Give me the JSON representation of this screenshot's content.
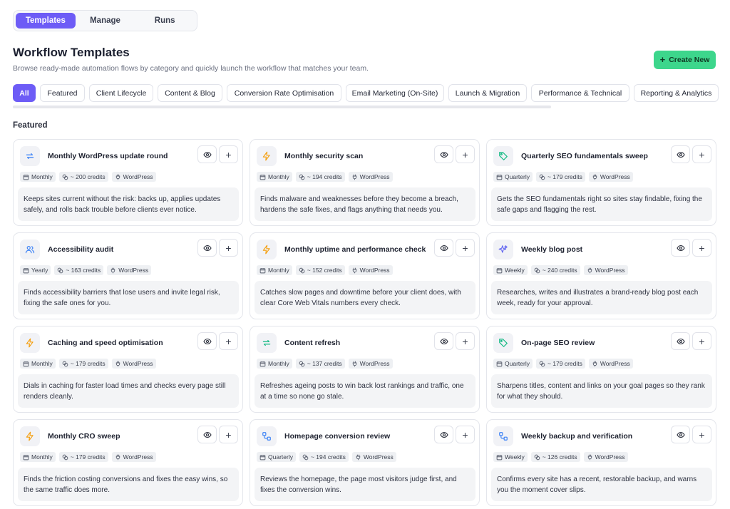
{
  "nav": {
    "tabs": [
      {
        "label": "Templates",
        "active": true
      },
      {
        "label": "Manage",
        "active": false
      },
      {
        "label": "Runs",
        "active": false
      }
    ]
  },
  "header": {
    "title": "Workflow Templates",
    "subtitle": "Browse ready-made automation flows by category and quickly launch the workflow that matches your team.",
    "create_label": "Create New"
  },
  "filters": [
    {
      "label": "All",
      "active": true
    },
    {
      "label": "Featured",
      "active": false
    },
    {
      "label": "Client Lifecycle",
      "active": false
    },
    {
      "label": "Content & Blog",
      "active": false
    },
    {
      "label": "Conversion Rate Optimisation",
      "active": false
    },
    {
      "label": "Email Marketing (On-Site)",
      "active": false
    },
    {
      "label": "Launch & Migration",
      "active": false
    },
    {
      "label": "Performance & Technical",
      "active": false
    },
    {
      "label": "Reporting & Analytics",
      "active": false
    }
  ],
  "section_label": "Featured",
  "colors": {
    "accent": "#6d5cf6",
    "create": "#3dd68c",
    "icon_blue": "#3b82f6",
    "icon_orange": "#f59e0b",
    "icon_green": "#10b981",
    "icon_purple": "#6366f1"
  },
  "cards": [
    {
      "title": "Monthly WordPress update round",
      "icon": "refresh-icon",
      "frequency": "Monthly",
      "credits": "~ 200 credits",
      "platform": "WordPress",
      "description": "Keeps sites current without the risk: backs up, applies updates safely, and rolls back trouble before clients ever notice."
    },
    {
      "title": "Monthly security scan",
      "icon": "bolt-icon",
      "frequency": "Monthly",
      "credits": "~ 194 credits",
      "platform": "WordPress",
      "description": "Finds malware and weaknesses before they become a breach, hardens the safe fixes, and flags anything that needs you."
    },
    {
      "title": "Quarterly SEO fundamentals sweep",
      "icon": "tag-icon",
      "frequency": "Quarterly",
      "credits": "~ 179 credits",
      "platform": "WordPress",
      "description": "Gets the SEO fundamentals right so sites stay findable, fixing the safe gaps and flagging the rest."
    },
    {
      "title": "Accessibility audit",
      "icon": "users-icon",
      "frequency": "Yearly",
      "credits": "~ 163 credits",
      "platform": "WordPress",
      "description": "Finds accessibility barriers that lose users and invite legal risk, fixing the safe ones for you."
    },
    {
      "title": "Monthly uptime and performance check",
      "icon": "bolt-icon",
      "frequency": "Monthly",
      "credits": "~ 152 credits",
      "platform": "WordPress",
      "description": "Catches slow pages and downtime before your client does, with clear Core Web Vitals numbers every check."
    },
    {
      "title": "Weekly blog post",
      "icon": "sparkles-icon",
      "frequency": "Weekly",
      "credits": "~ 240 credits",
      "platform": "WordPress",
      "description": "Researches, writes and illustrates a brand-ready blog post each week, ready for your approval."
    },
    {
      "title": "Caching and speed optimisation",
      "icon": "bolt-icon",
      "frequency": "Monthly",
      "credits": "~ 179 credits",
      "platform": "WordPress",
      "description": "Dials in caching for faster load times and checks every page still renders cleanly."
    },
    {
      "title": "Content refresh",
      "icon": "refresh-green-icon",
      "frequency": "Monthly",
      "credits": "~ 137 credits",
      "platform": "WordPress",
      "description": "Refreshes ageing posts to win back lost rankings and traffic, one at a time so none go stale."
    },
    {
      "title": "On-page SEO review",
      "icon": "tag-icon",
      "frequency": "Quarterly",
      "credits": "~ 179 credits",
      "platform": "WordPress",
      "description": "Sharpens titles, content and links on your goal pages so they rank for what they should."
    },
    {
      "title": "Monthly CRO sweep",
      "icon": "bolt-icon",
      "frequency": "Monthly",
      "credits": "~ 179 credits",
      "platform": "WordPress",
      "description": "Finds the friction costing conversions and fixes the easy wins, so the same traffic does more."
    },
    {
      "title": "Homepage conversion review",
      "icon": "flow-icon",
      "frequency": "Quarterly",
      "credits": "~ 194 credits",
      "platform": "WordPress",
      "description": "Reviews the homepage, the page most visitors judge first, and fixes the conversion wins."
    },
    {
      "title": "Weekly backup and verification",
      "icon": "flow-icon",
      "frequency": "Weekly",
      "credits": "~ 126 credits",
      "platform": "WordPress",
      "description": "Confirms every site has a recent, restorable backup, and warns you the moment cover slips."
    }
  ]
}
